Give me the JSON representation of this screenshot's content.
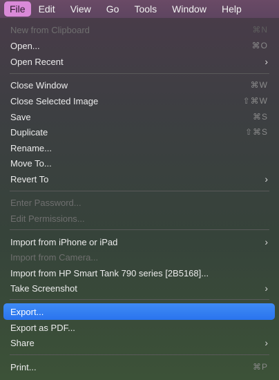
{
  "menubar": {
    "items": [
      "File",
      "Edit",
      "View",
      "Go",
      "Tools",
      "Window",
      "Help"
    ]
  },
  "menu": {
    "items": [
      {
        "label": "New from Clipboard",
        "shortcut": "⌘N"
      },
      {
        "label": "Open...",
        "shortcut": "⌘O"
      },
      {
        "label": "Open Recent",
        "submenu": "›"
      },
      {
        "label": "Close Window",
        "shortcut": "⌘W"
      },
      {
        "label": "Close Selected Image",
        "shortcut": "⇧⌘W"
      },
      {
        "label": "Save",
        "shortcut": "⌘S"
      },
      {
        "label": "Duplicate",
        "shortcut": "⇧⌘S"
      },
      {
        "label": "Rename..."
      },
      {
        "label": "Move To..."
      },
      {
        "label": "Revert To",
        "submenu": "›"
      },
      {
        "label": "Enter Password..."
      },
      {
        "label": "Edit Permissions..."
      },
      {
        "label": "Import from iPhone or iPad",
        "submenu": "›"
      },
      {
        "label": "Import from Camera..."
      },
      {
        "label": "Import from HP Smart Tank 790 series [2B5168]..."
      },
      {
        "label": "Take Screenshot",
        "submenu": "›"
      },
      {
        "label": "Export..."
      },
      {
        "label": "Export as PDF..."
      },
      {
        "label": "Share",
        "submenu": "›"
      },
      {
        "label": "Print...",
        "shortcut": "⌘P"
      }
    ]
  }
}
